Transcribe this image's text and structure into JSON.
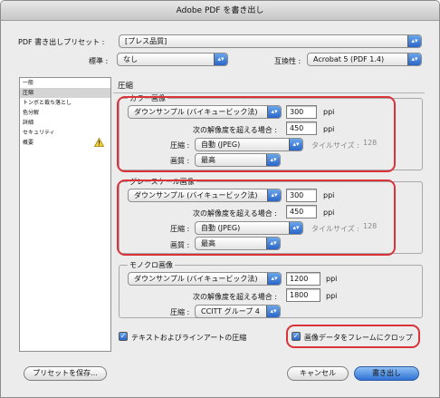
{
  "window": {
    "title": "Adobe PDF を書き出し"
  },
  "preset": {
    "label": "PDF 書き出しプリセット :",
    "value": "[プレス品質]"
  },
  "standard": {
    "label": "標準 :",
    "value": "なし"
  },
  "compat": {
    "label": "互換性 :",
    "value": "Acrobat 5 (PDF 1.4)"
  },
  "sidebar": {
    "items": [
      {
        "label": "一般"
      },
      {
        "label": "圧縮"
      },
      {
        "label": "トンボと裁ち落とし"
      },
      {
        "label": "色分解"
      },
      {
        "label": "詳細"
      },
      {
        "label": "セキュリティ"
      },
      {
        "label": "概要"
      }
    ],
    "selected_index": 1
  },
  "section_title": "圧縮",
  "color": {
    "title": "カラー画像",
    "sampling": "ダウンサンプル (バイキュービック法)",
    "ppi": "300",
    "ppi_unit": "ppi",
    "above_label": "次の解像度を超える場合 :",
    "above": "450",
    "above_unit": "ppi",
    "compression_label": "圧縮 :",
    "compression": "自動 (JPEG)",
    "tile_label": "タイルサイズ :",
    "tile": "128",
    "quality_label": "画質 :",
    "quality": "最高"
  },
  "gray": {
    "title": "グレースケール画像",
    "sampling": "ダウンサンプル (バイキュービック法)",
    "ppi": "300",
    "ppi_unit": "ppi",
    "above_label": "次の解像度を超える場合 :",
    "above": "450",
    "above_unit": "ppi",
    "compression_label": "圧縮 :",
    "compression": "自動 (JPEG)",
    "tile_label": "タイルサイズ :",
    "tile": "128",
    "quality_label": "画質 :",
    "quality": "最高"
  },
  "mono": {
    "title": "モノクロ画像",
    "sampling": "ダウンサンプル (バイキュービック法)",
    "ppi": "1200",
    "ppi_unit": "ppi",
    "above_label": "次の解像度を超える場合 :",
    "above": "1800",
    "above_unit": "ppi",
    "compression_label": "圧縮 :",
    "compression": "CCITT グループ 4"
  },
  "options": {
    "text_compress": "テキストおよびラインアートの圧縮",
    "crop": "画像データをフレームにクロップ"
  },
  "buttons": {
    "save_preset": "プリセットを保存...",
    "cancel": "キャンセル",
    "export": "書き出し"
  },
  "colors": {
    "accent": "#2f72d4",
    "highlight": "#d8343a"
  }
}
